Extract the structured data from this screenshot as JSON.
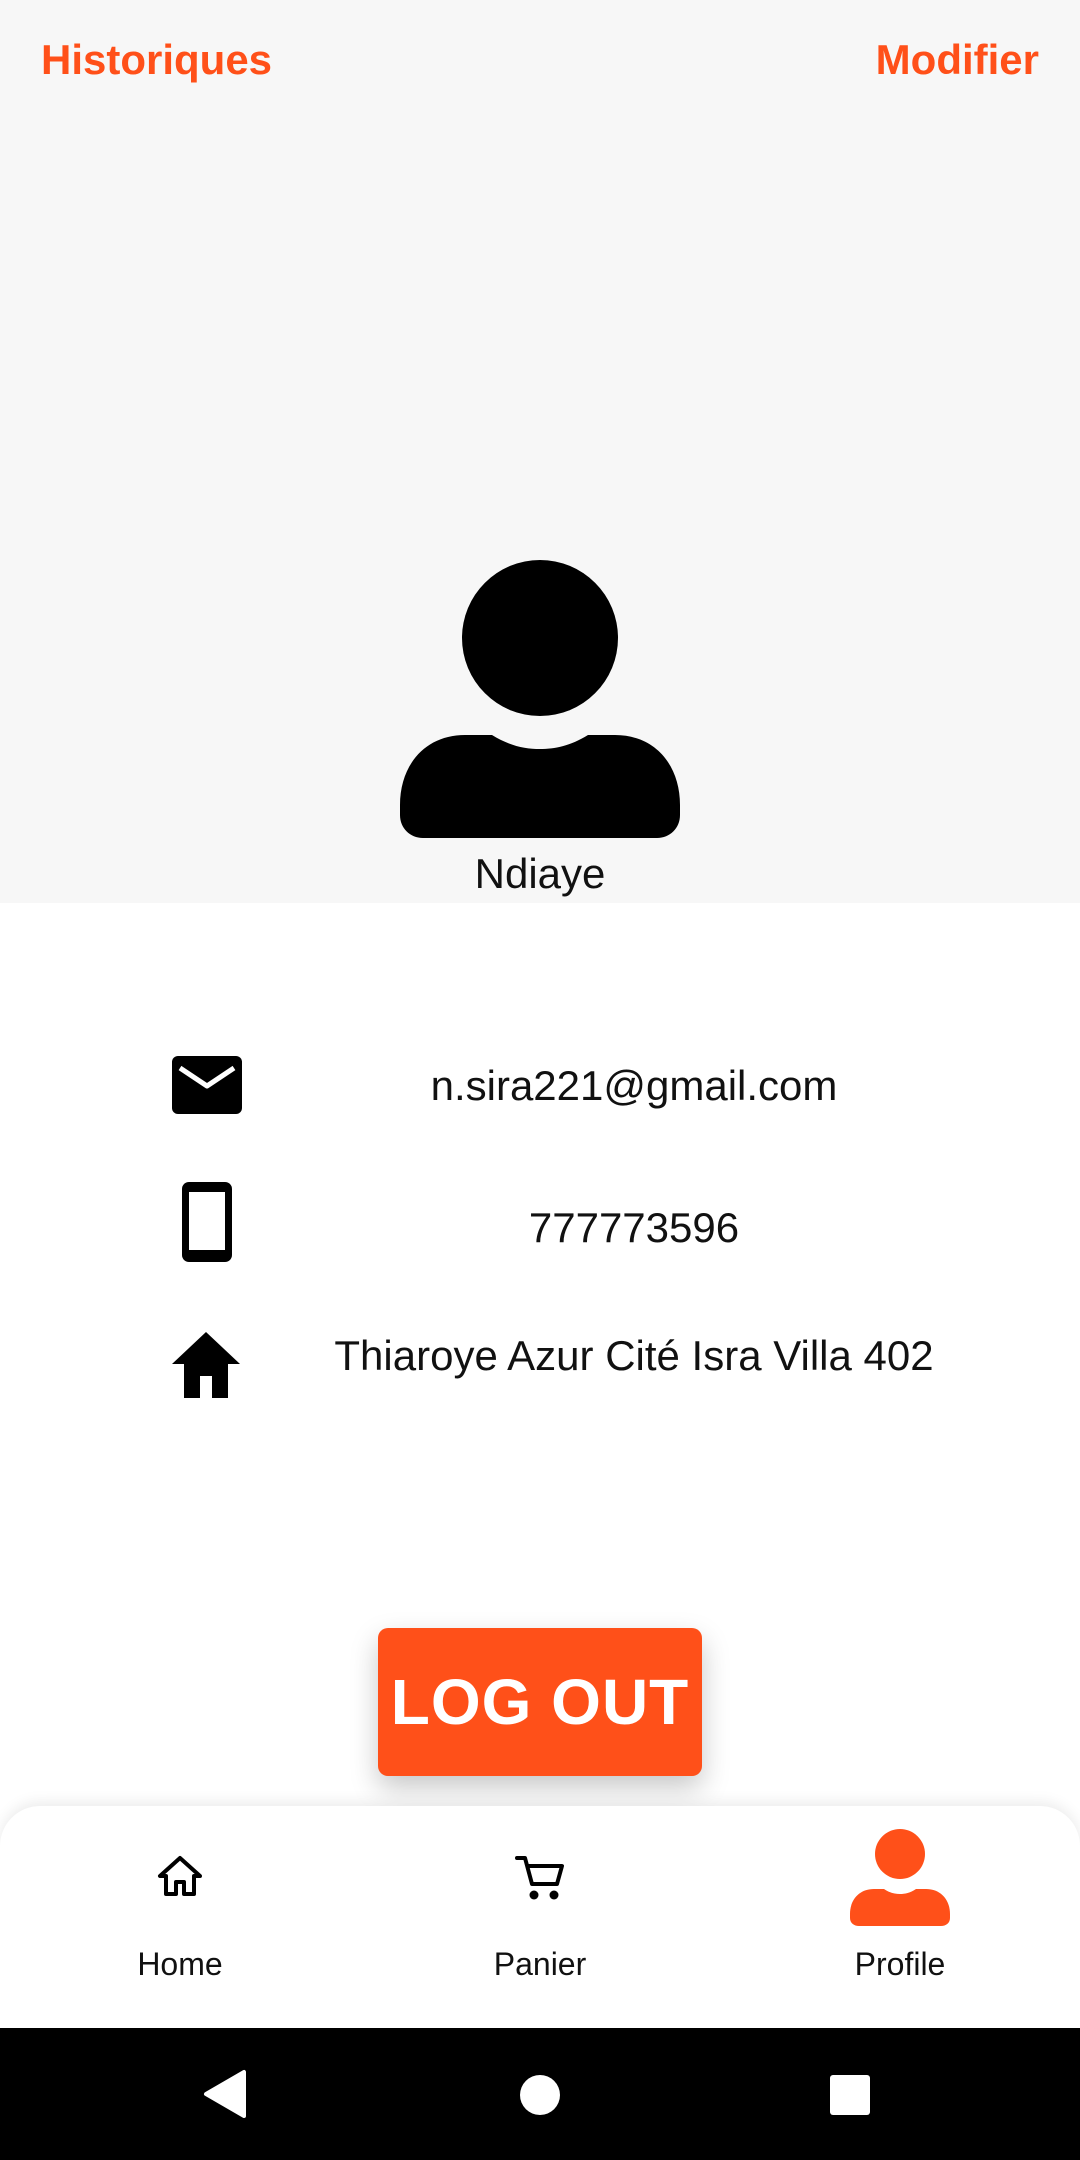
{
  "header": {
    "history_label": "Historiques",
    "edit_label": "Modifier"
  },
  "profile": {
    "name": "Ndiaye",
    "email": "n.sira221@gmail.com",
    "phone": "777773596",
    "address": "Thiaroye Azur Cité Isra Villa 402"
  },
  "actions": {
    "logout_label": "LOG OUT"
  },
  "bottom_nav": {
    "items": [
      {
        "label": "Home",
        "icon": "home-outline-icon"
      },
      {
        "label": "Panier",
        "icon": "cart-icon"
      },
      {
        "label": "Profile",
        "icon": "person-icon",
        "active": true
      }
    ]
  },
  "system_nav": {
    "buttons": [
      "back-icon",
      "home-circle-icon",
      "recents-square-icon"
    ]
  },
  "colors": {
    "accent": "#ff5019",
    "header_bg": "#f7f7f7",
    "text": "#111111"
  }
}
